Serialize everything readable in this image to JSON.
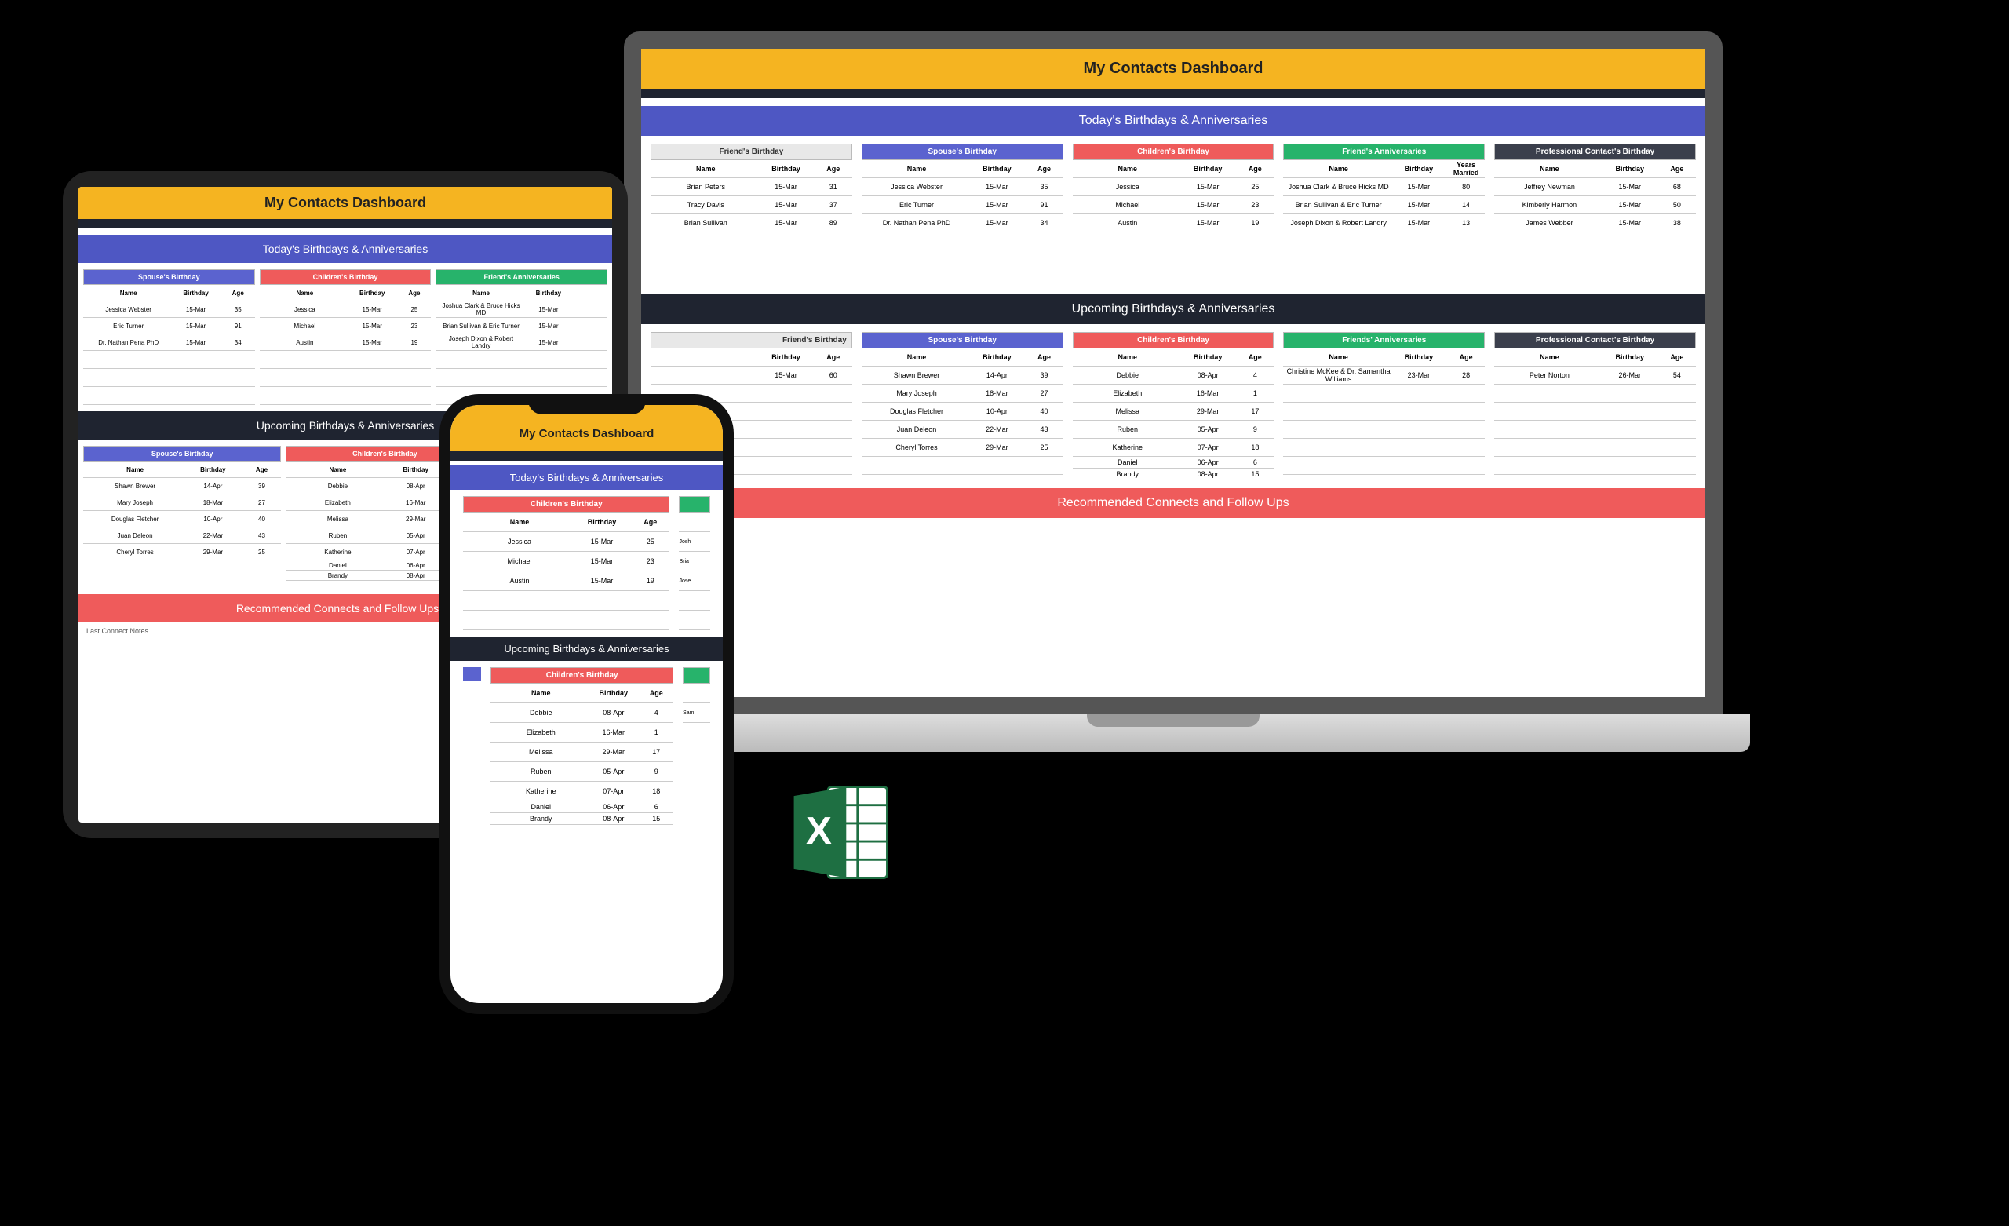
{
  "title": "My Contacts Dashboard",
  "sections": {
    "today": "Today's Birthdays & Anniversaries",
    "upcoming": "Upcoming Birthdays & Anniversaries",
    "recommended": "Recommended Connects and Follow Ups"
  },
  "headers": {
    "friend_bday": "Friend's Birthday",
    "spouse_bday": "Spouse's Birthday",
    "children_bday": "Children's Birthday",
    "friend_anniv": "Friend's Anniversaries",
    "friends_anniv": "Friends' Anniversaries",
    "prof_bday": "Professional Contact's Birthday"
  },
  "thead": {
    "name": "Name",
    "birthday": "Birthday",
    "age": "Age",
    "years_married": "Years Married"
  },
  "today_data": {
    "friend": [
      {
        "name": "Brian Peters",
        "date": "15-Mar",
        "val": "31"
      },
      {
        "name": "Tracy Davis",
        "date": "15-Mar",
        "val": "37"
      },
      {
        "name": "Brian Sullivan",
        "date": "15-Mar",
        "val": "89"
      }
    ],
    "spouse": [
      {
        "name": "Jessica Webster",
        "date": "15-Mar",
        "val": "35"
      },
      {
        "name": "Eric Turner",
        "date": "15-Mar",
        "val": "91"
      },
      {
        "name": "Dr. Nathan Pena PhD",
        "date": "15-Mar",
        "val": "34"
      }
    ],
    "children": [
      {
        "name": "Jessica",
        "date": "15-Mar",
        "val": "25"
      },
      {
        "name": "Michael",
        "date": "15-Mar",
        "val": "23"
      },
      {
        "name": "Austin",
        "date": "15-Mar",
        "val": "19"
      }
    ],
    "anniv": [
      {
        "name": "Joshua Clark & Bruce Hicks MD",
        "date": "15-Mar",
        "val": "80"
      },
      {
        "name": "Brian Sullivan & Eric Turner",
        "date": "15-Mar",
        "val": "14"
      },
      {
        "name": "Joseph Dixon & Robert Landry",
        "date": "15-Mar",
        "val": "13"
      }
    ],
    "prof": [
      {
        "name": "Jeffrey Newman",
        "date": "15-Mar",
        "val": "68"
      },
      {
        "name": "Kimberly Harmon",
        "date": "15-Mar",
        "val": "50"
      },
      {
        "name": "James Webber",
        "date": "15-Mar",
        "val": "38"
      }
    ]
  },
  "upcoming_data": {
    "friend": [
      {
        "name": "",
        "date": "15-Mar",
        "val": "60"
      }
    ],
    "spouse": [
      {
        "name": "Shawn Brewer",
        "date": "14-Apr",
        "val": "39"
      },
      {
        "name": "Mary Joseph",
        "date": "18-Mar",
        "val": "27"
      },
      {
        "name": "Douglas Fletcher",
        "date": "10-Apr",
        "val": "40"
      },
      {
        "name": "Juan Deleon",
        "date": "22-Mar",
        "val": "43"
      },
      {
        "name": "Cheryl Torres",
        "date": "29-Mar",
        "val": "25"
      }
    ],
    "children": [
      {
        "name": "Debbie",
        "date": "08-Apr",
        "val": "4"
      },
      {
        "name": "Elizabeth",
        "date": "16-Mar",
        "val": "1"
      },
      {
        "name": "Melissa",
        "date": "29-Mar",
        "val": "17"
      },
      {
        "name": "Ruben",
        "date": "05-Apr",
        "val": "9"
      },
      {
        "name": "Katherine",
        "date": "07-Apr",
        "val": "18"
      },
      {
        "name": "Daniel",
        "date": "06-Apr",
        "val": "6"
      },
      {
        "name": "Brandy",
        "date": "08-Apr",
        "val": "15"
      }
    ],
    "anniv": [
      {
        "name": "Christine McKee & Dr. Samantha Williams",
        "date": "23-Mar",
        "val": "28"
      }
    ],
    "prof": [
      {
        "name": "Peter Norton",
        "date": "26-Mar",
        "val": "54"
      }
    ]
  },
  "tablet": {
    "footer_partial": "Last Connect    Notes"
  }
}
